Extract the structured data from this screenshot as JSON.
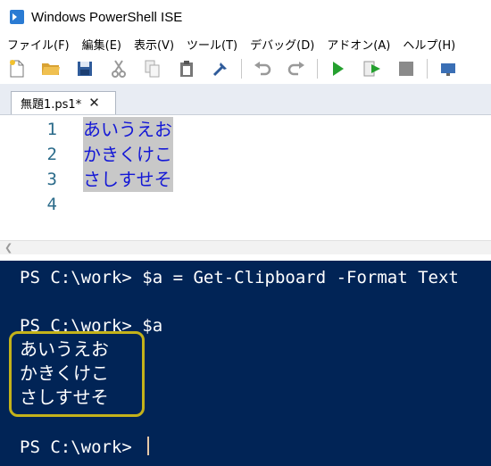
{
  "window": {
    "title": "Windows PowerShell ISE"
  },
  "menu": [
    "ファイル(F)",
    "編集(E)",
    "表示(V)",
    "ツール(T)",
    "デバッグ(D)",
    "アドオン(A)",
    "ヘルプ(H)"
  ],
  "toolbar": {
    "icons": [
      "new-file-icon",
      "open-folder-icon",
      "save-icon",
      "cut-icon",
      "copy-icon",
      "paste-icon",
      "clear-icon",
      "undo-icon",
      "redo-icon",
      "run-icon",
      "run-selection-icon",
      "stop-icon",
      "remote-icon"
    ]
  },
  "tab": {
    "label": "無題1.ps1*",
    "close": "✕"
  },
  "editor": {
    "lines": [
      {
        "num": "1",
        "text": "あいうえお"
      },
      {
        "num": "2",
        "text": "かきくけこ"
      },
      {
        "num": "3",
        "text": "さしすせそ"
      },
      {
        "num": "4",
        "text": ""
      }
    ]
  },
  "console": {
    "line1": "PS C:\\work> $a = Get-Clipboard -Format Text",
    "line2": "PS C:\\work> $a",
    "out1": "あいうえお",
    "out2": "かきくけこ",
    "out3": "さしすせそ",
    "prompt": "PS C:\\work> "
  },
  "colors": {
    "console_bg": "#012456",
    "editor_text": "#1418d6",
    "selection": "#c8c8c8",
    "highlight_border": "#c4b21a"
  }
}
